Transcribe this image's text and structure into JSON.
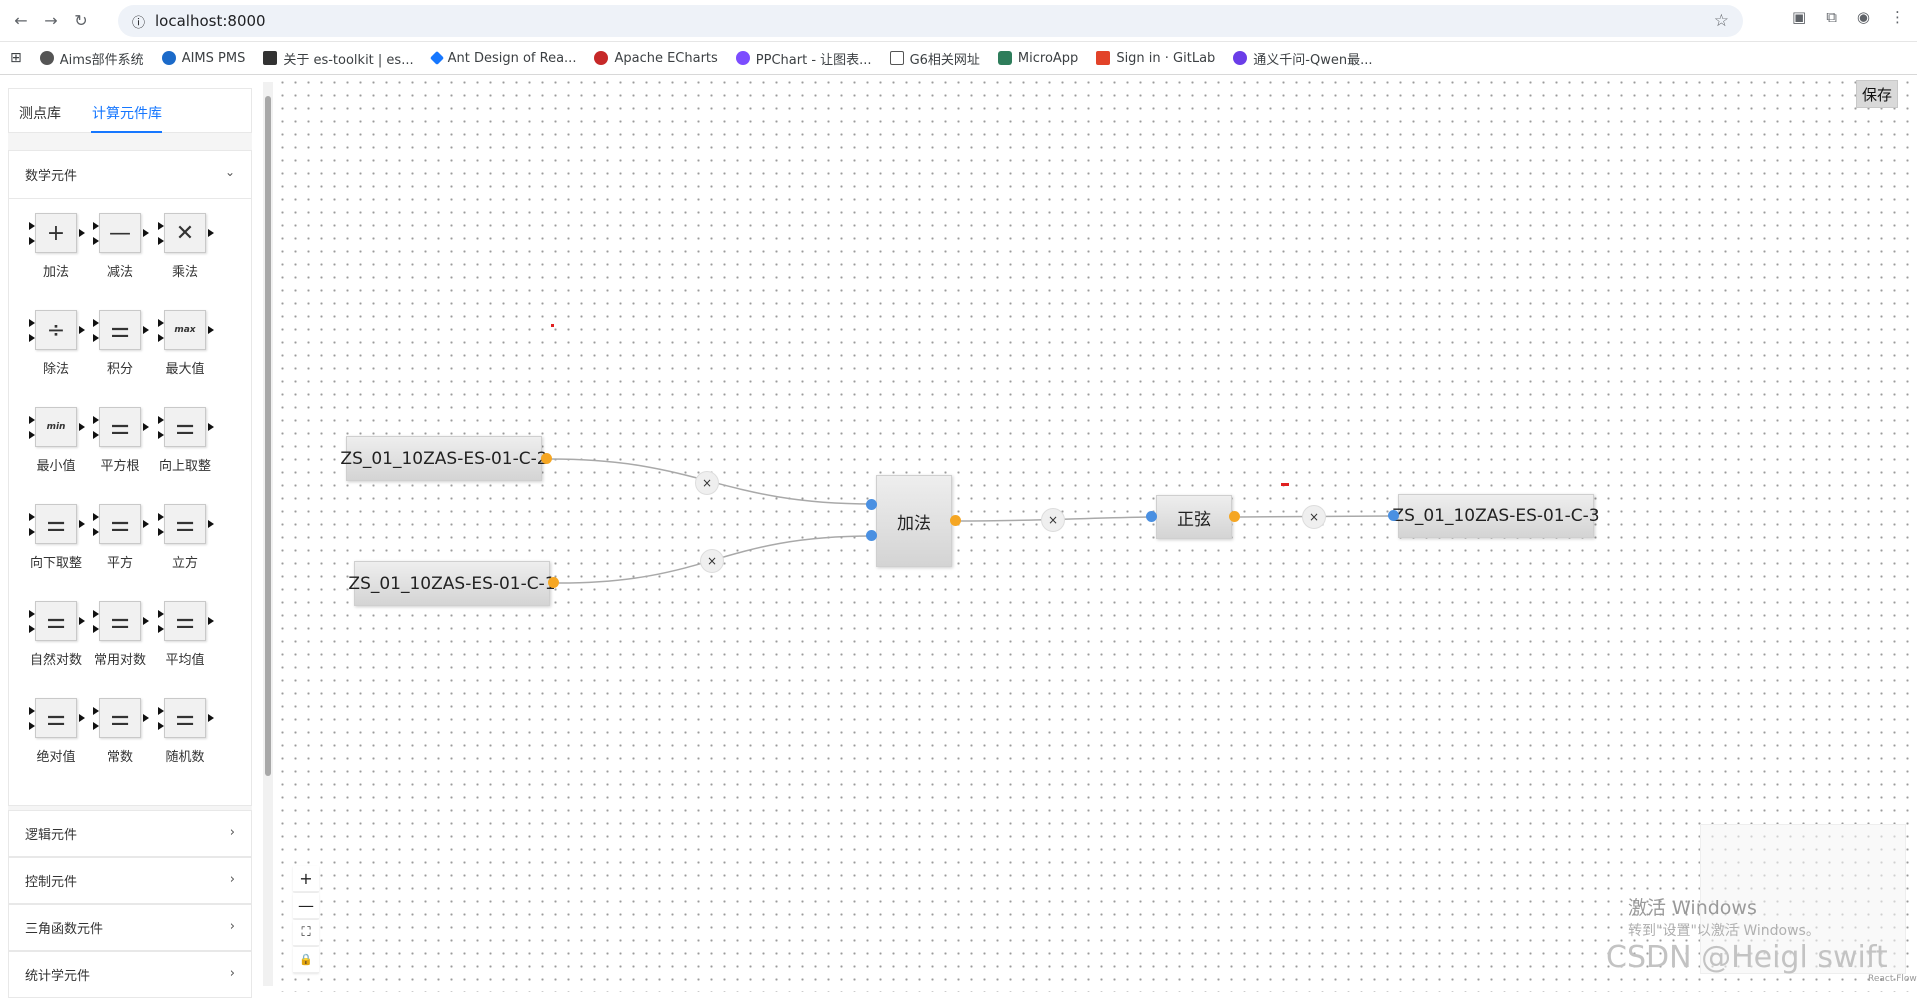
{
  "browser": {
    "url": "localhost:8000",
    "bookmarks": [
      "Aims部件系统",
      "AIMS PMS",
      "关于 es-toolkit | es...",
      "Ant Design of Rea...",
      "Apache ECharts",
      "PPChart - 让图表...",
      "G6相关网址",
      "MicroApp",
      "Sign in · GitLab",
      "通义千问-Qwen最..."
    ]
  },
  "sidebar": {
    "tabs": [
      "测点库",
      "计算元件库"
    ],
    "active_tab": "计算元件库",
    "math_section_title": "数学元件",
    "components": [
      {
        "label": "加法",
        "icon": "plus-icon",
        "glyph": "+"
      },
      {
        "label": "减法",
        "icon": "minus-icon",
        "glyph": "—"
      },
      {
        "label": "乘法",
        "icon": "multiply-icon",
        "glyph": "✕"
      },
      {
        "label": "除法",
        "icon": "divide-icon",
        "glyph": "÷"
      },
      {
        "label": "积分",
        "icon": "sliders-icon",
        "glyph": "⚌"
      },
      {
        "label": "最大值",
        "icon": "max-icon",
        "glyph": "max"
      },
      {
        "label": "最小值",
        "icon": "min-icon",
        "glyph": "min"
      },
      {
        "label": "平方根",
        "icon": "sliders-icon",
        "glyph": "⚌"
      },
      {
        "label": "向上取整",
        "icon": "sliders-icon",
        "glyph": "⚌"
      },
      {
        "label": "向下取整",
        "icon": "sliders-icon",
        "glyph": "⚌"
      },
      {
        "label": "平方",
        "icon": "sliders-icon",
        "glyph": "⚌"
      },
      {
        "label": "立方",
        "icon": "sliders-icon",
        "glyph": "⚌"
      },
      {
        "label": "自然对数",
        "icon": "sliders-icon",
        "glyph": "⚌"
      },
      {
        "label": "常用对数",
        "icon": "sliders-icon",
        "glyph": "⚌"
      },
      {
        "label": "平均值",
        "icon": "sliders-icon",
        "glyph": "⚌"
      },
      {
        "label": "绝对值",
        "icon": "sliders-icon",
        "glyph": "⚌"
      },
      {
        "label": "常数",
        "icon": "sliders-icon",
        "glyph": "⚌"
      },
      {
        "label": "随机数",
        "icon": "sliders-icon",
        "glyph": "⚌"
      }
    ],
    "collapsed_sections": [
      "逻辑元件",
      "控制元件",
      "三角函数元件",
      "统计学元件"
    ]
  },
  "canvas": {
    "save_label": "保存",
    "nodes": {
      "input_c2": "ZS_01_10ZAS-ES-01-C-2",
      "input_c1": "ZS_01_10ZAS-ES-01-C-1",
      "add": "加法",
      "sine": "正弦",
      "output_c3": "ZS_01_10ZAS-ES-01-C-3"
    },
    "edge_delete_glyph": "×",
    "controls": {
      "zoom_in": "+",
      "zoom_out": "—",
      "fit": "⛶",
      "lock": "🔒"
    },
    "attribution": "React Flow"
  },
  "overlay": {
    "activate_title": "激活 Windows",
    "activate_hint": "转到\"设置\"以激活 Windows。",
    "csdn": "CSDN @Heigl swift"
  },
  "colors": {
    "accent": "#1677ff",
    "handle_out": "#f5a623",
    "handle_in": "#4a90e2"
  }
}
